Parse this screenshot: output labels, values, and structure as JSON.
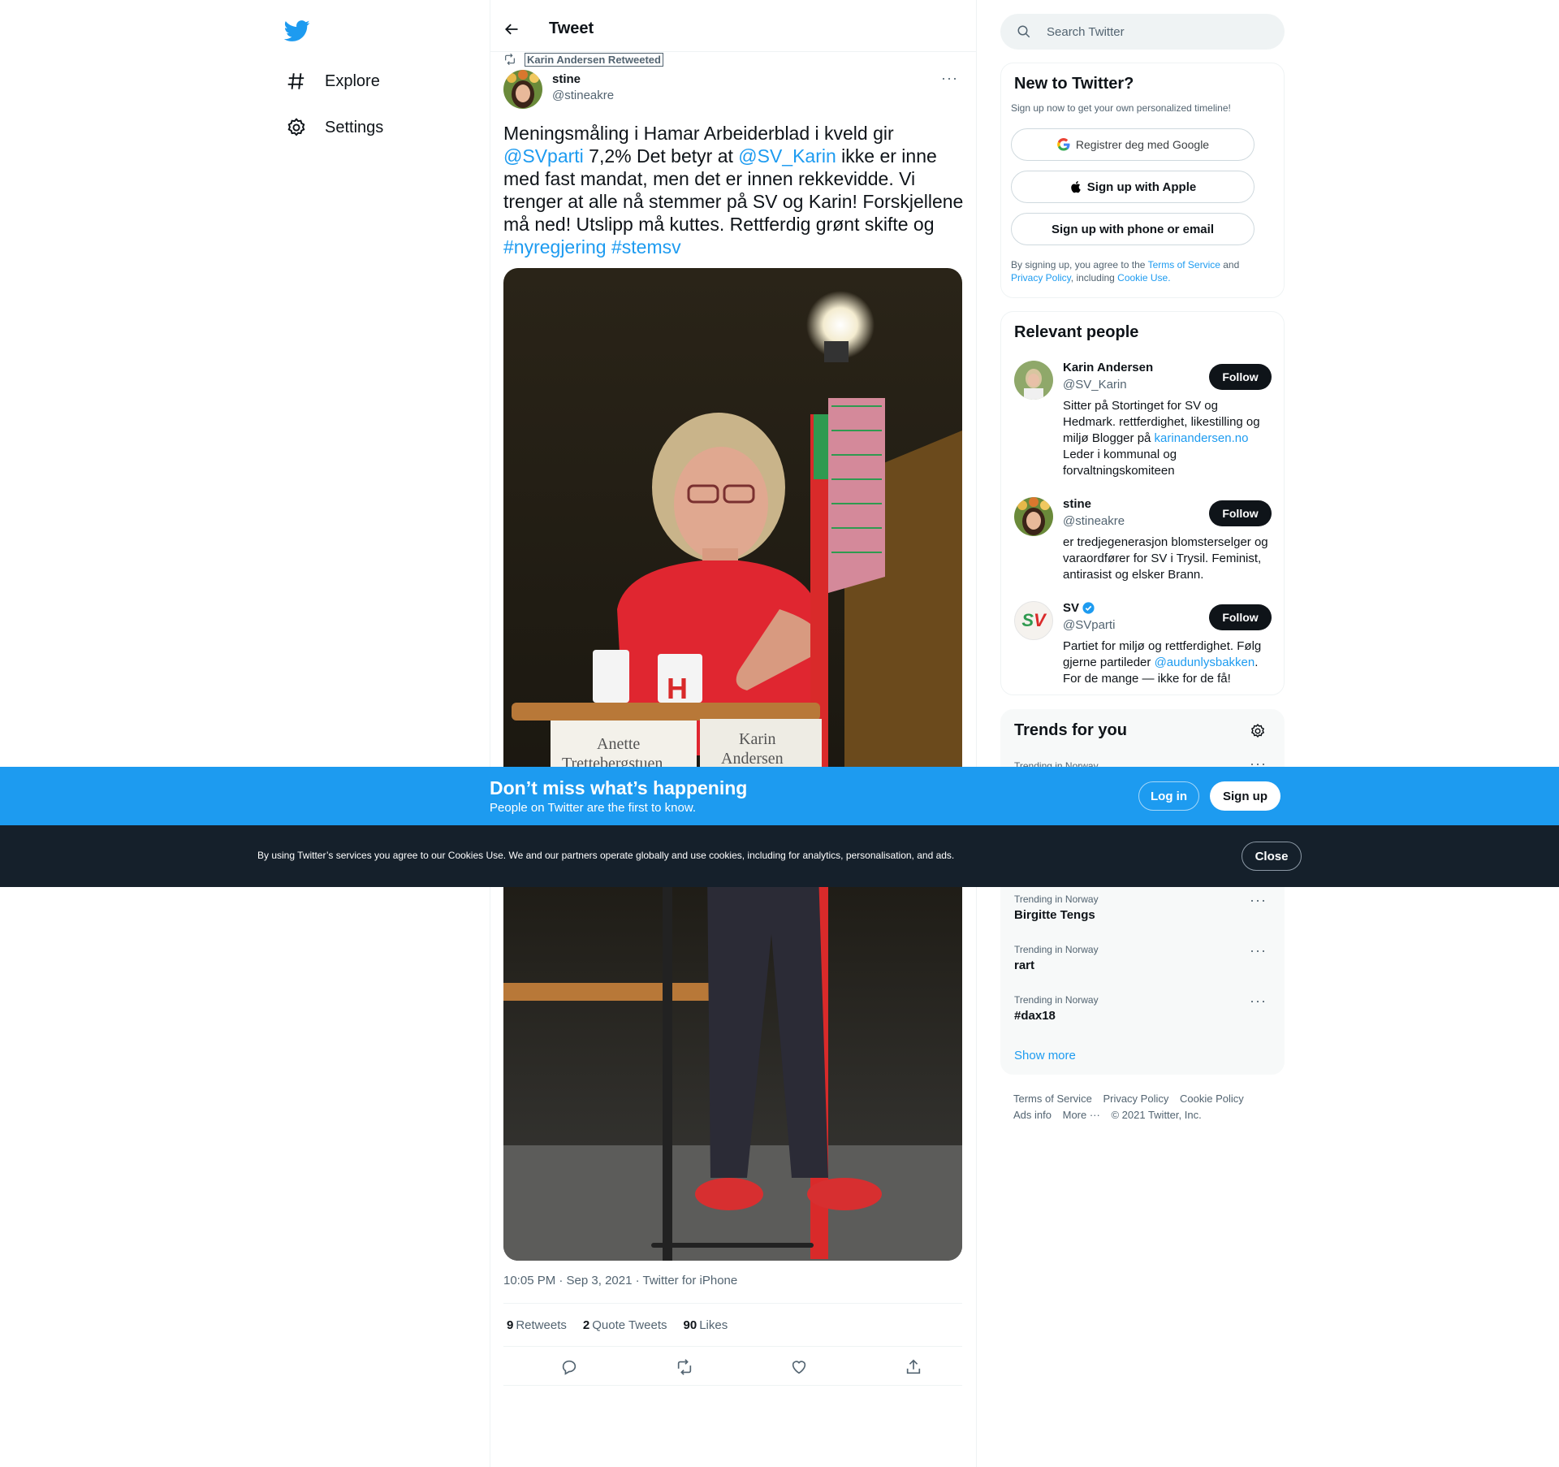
{
  "nav": {
    "explore_label": "Explore",
    "settings_label": "Settings"
  },
  "header": {
    "title": "Tweet"
  },
  "tweet": {
    "retweeted_by": "Karin Andersen Retweeted",
    "author_name": "stine",
    "author_handle": "@stineakre",
    "text_parts": {
      "p1": "Meningsmåling i Hamar Arbeiderblad i kveld gir ",
      "m1": "@SVparti",
      "p2": " 7,2% Det betyr at ",
      "m2": "@SV_Karin",
      "p3": " ikke er inne med fast mandat, men det er innen rekkevidde. Vi trenger at alle nå stemmer på SV og Karin! Forskjellene må ned! Utslipp må kuttes. Rettferdig grønt skifte og ",
      "h1": "#nyregjering",
      "h2": "#stemsv"
    },
    "photo_text": {
      "placard_left_1": "Anette",
      "placard_left_2": "Trettebergstuen",
      "placard_right_1": "Karin",
      "placard_right_2": "Andersen",
      "mug_letter": "H"
    },
    "meta": "10:05 PM · Sep 3, 2021 · Twitter for iPhone",
    "stats": {
      "retweets_count": "9",
      "retweets_label": "Retweets",
      "quotes_count": "2",
      "quotes_label": "Quote Tweets",
      "likes_count": "90",
      "likes_label": "Likes"
    }
  },
  "search": {
    "placeholder": "Search Twitter"
  },
  "signup_card": {
    "title": "New to Twitter?",
    "subtitle": "Sign up now to get your own personalized timeline!",
    "google_label": "Registrer deg med Google",
    "apple_label": "Sign up with Apple",
    "phone_label": "Sign up with phone or email",
    "legal_1": "By signing up, you agree to the ",
    "legal_tos": "Terms of Service",
    "legal_2": " and ",
    "legal_privacy": "Privacy Policy",
    "legal_3": ", including ",
    "legal_cookie": "Cookie Use."
  },
  "relevant_people": {
    "title": "Relevant people",
    "follow_label": "Follow",
    "people": [
      {
        "name": "Karin Andersen",
        "handle": "@SV_Karin",
        "bio_1": "Sitter på Stortinget for SV og Hedmark. rettferdighet, likestilling og miljø Blogger på ",
        "bio_link": "karinandersen.no",
        "bio_2": " Leder i kommunal og forvaltningskomiteen"
      },
      {
        "name": "stine",
        "handle": "@stineakre",
        "bio_1": "er tredjegenerasjon blomsterselger og varaordfører for SV i Trysil. Feminist, antirasist og elsker Brann."
      },
      {
        "name": "SV",
        "handle": "@SVparti",
        "avatar_text": "SV",
        "bio_1": "Partiet for miljø og rettferdighet. Følg gjerne partileder ",
        "bio_link": "@audunlysbakken",
        "bio_2": ". For de mange — ikke for de få!"
      }
    ]
  },
  "trends": {
    "title": "Trends for you",
    "items": [
      {
        "sub": "Trending in Norway",
        "name": ""
      },
      {
        "sub": "Trending in Norway",
        "name": "Birgitte Tengs"
      },
      {
        "sub": "Trending in Norway",
        "name": "rart"
      },
      {
        "sub": "Trending in Norway",
        "name": "#dax18"
      }
    ],
    "show_more": "Show more"
  },
  "footer": {
    "tos": "Terms of Service",
    "privacy": "Privacy Policy",
    "cookie": "Cookie Policy",
    "ads": "Ads info",
    "more": "More ···",
    "copyright": "© 2021 Twitter, Inc."
  },
  "banner": {
    "title": "Don’t miss what’s happening",
    "subtitle": "People on Twitter are the first to know.",
    "login_label": "Log in",
    "signup_label": "Sign up"
  },
  "cookie_bar": {
    "text": "By using Twitter’s services you agree to our Cookies Use. We and our partners operate globally and use cookies, including for analytics, personalisation, and ads.",
    "close_label": "Close"
  },
  "colors": {
    "accent": "#1d9bf0",
    "text_primary": "#0f1419",
    "text_secondary": "#536471",
    "cookie_bg": "#15202b"
  }
}
